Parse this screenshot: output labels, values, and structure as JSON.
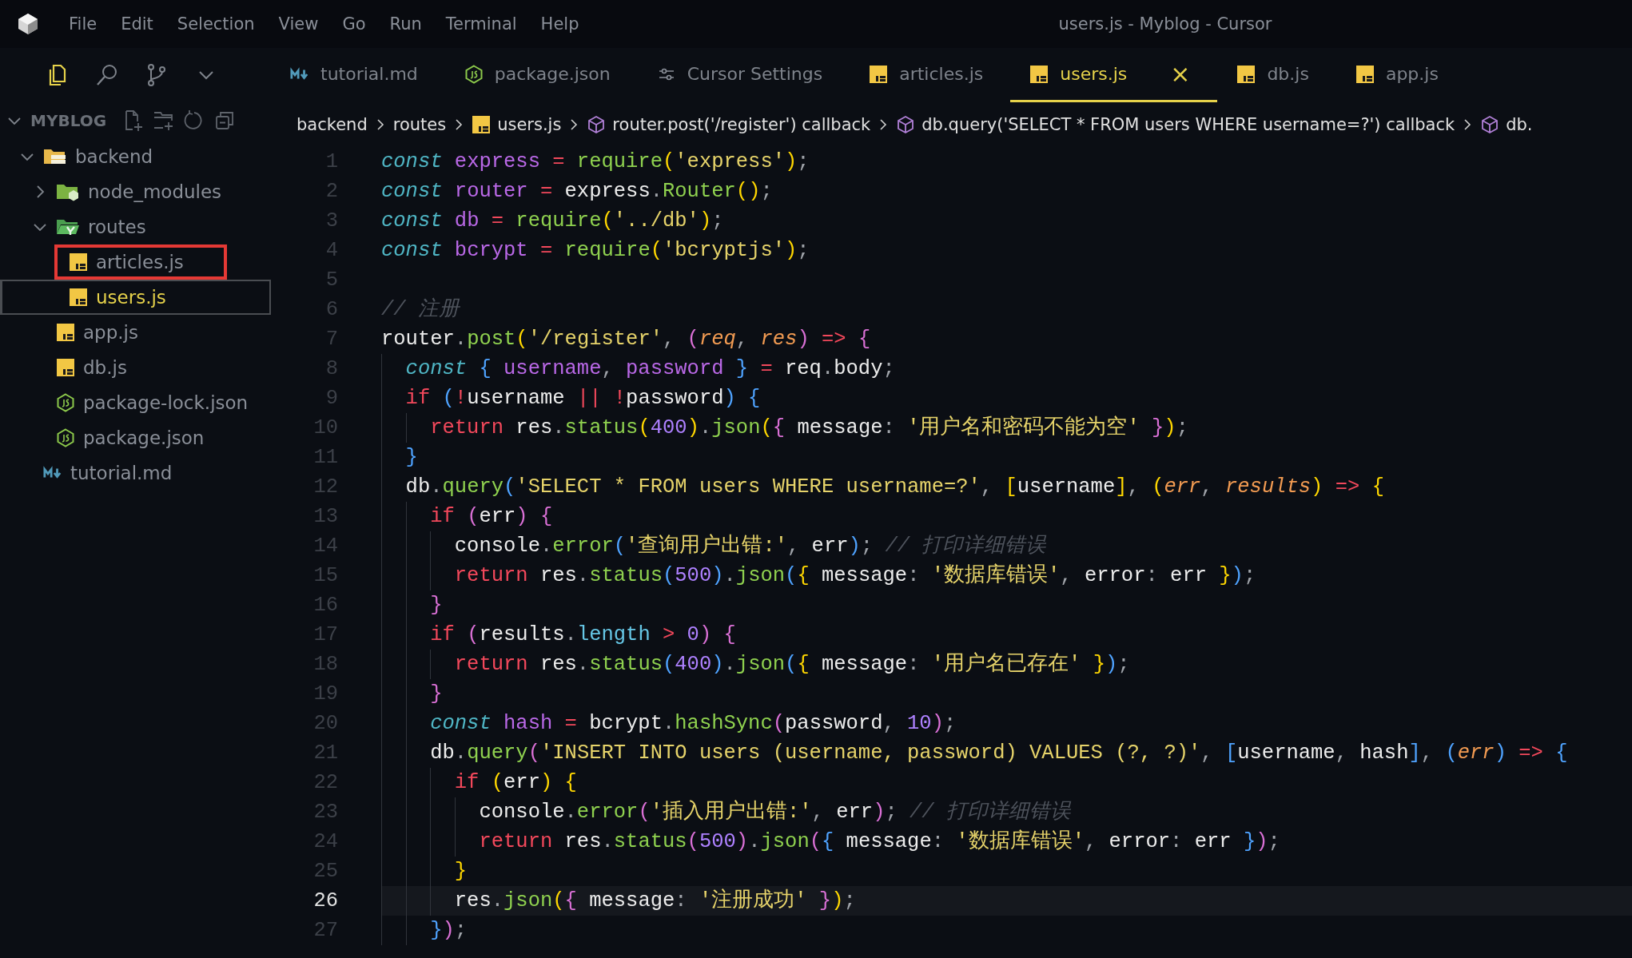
{
  "menu": {
    "items": [
      "File",
      "Edit",
      "Selection",
      "View",
      "Go",
      "Run",
      "Terminal",
      "Help"
    ]
  },
  "window": {
    "title": "users.js - Myblog - Cursor"
  },
  "tabs": [
    {
      "label": "tutorial.md",
      "kind": "md",
      "selected": false
    },
    {
      "label": "package.json",
      "kind": "json",
      "selected": false
    },
    {
      "label": "Cursor Settings",
      "kind": "settings",
      "selected": false
    },
    {
      "label": "articles.js",
      "kind": "js",
      "selected": false
    },
    {
      "label": "users.js",
      "kind": "js",
      "selected": true,
      "close": "×"
    },
    {
      "label": "db.js",
      "kind": "js",
      "selected": false
    },
    {
      "label": "app.js",
      "kind": "js",
      "selected": false
    }
  ],
  "explorer": {
    "title": "MYBLOG",
    "items": [
      {
        "label": "backend",
        "kind": "server-folder",
        "expanded": true,
        "selected": false,
        "annotated": false,
        "children": [
          {
            "label": "node_modules",
            "kind": "package-folder",
            "expanded": false,
            "selected": false,
            "annotated": false
          },
          {
            "label": "routes",
            "kind": "route-folder",
            "expanded": true,
            "selected": false,
            "annotated": false,
            "children": [
              {
                "label": "articles.js",
                "kind": "js",
                "selected": false,
                "annotated": true
              },
              {
                "label": "users.js",
                "kind": "js",
                "selected": true,
                "annotated": false
              }
            ]
          },
          {
            "label": "app.js",
            "kind": "js",
            "selected": false,
            "annotated": false
          },
          {
            "label": "db.js",
            "kind": "js",
            "selected": false,
            "annotated": false
          },
          {
            "label": "package-lock.json",
            "kind": "json",
            "selected": false,
            "annotated": false
          },
          {
            "label": "package.json",
            "kind": "json",
            "selected": false,
            "annotated": false
          }
        ]
      },
      {
        "label": "tutorial.md",
        "kind": "md",
        "selected": false,
        "annotated": false
      }
    ]
  },
  "breadcrumb": [
    {
      "label": "backend",
      "kind": "folder"
    },
    {
      "label": "routes",
      "kind": "folder"
    },
    {
      "label": "users.js",
      "kind": "js"
    },
    {
      "label": "router.post('/register') callback",
      "kind": "symbol"
    },
    {
      "label": "db.query('SELECT * FROM users WHERE username=?') callback",
      "kind": "symbol"
    },
    {
      "label": "db.",
      "kind": "symbol"
    }
  ],
  "code": {
    "lines": [
      {
        "number": "1",
        "current": false,
        "tokens": [
          {
            "kind": "kw",
            "text": "const "
          },
          {
            "kind": "v",
            "text": "express "
          },
          {
            "kind": "c",
            "text": "= "
          },
          {
            "kind": "f",
            "text": "require"
          },
          {
            "kind": "b1",
            "text": "("
          },
          {
            "kind": "s",
            "text": "'express'"
          },
          {
            "kind": "b1",
            "text": ")"
          },
          {
            "kind": "d",
            "text": ";"
          }
        ]
      },
      {
        "number": "2",
        "current": false,
        "tokens": [
          {
            "kind": "kw",
            "text": "const "
          },
          {
            "kind": "v",
            "text": "router "
          },
          {
            "kind": "c",
            "text": "= "
          },
          {
            "kind": "p",
            "text": "express"
          },
          {
            "kind": "d",
            "text": "."
          },
          {
            "kind": "f",
            "text": "Router"
          },
          {
            "kind": "b1",
            "text": "()"
          },
          {
            "kind": "d",
            "text": ";"
          }
        ]
      },
      {
        "number": "3",
        "current": false,
        "tokens": [
          {
            "kind": "kw",
            "text": "const "
          },
          {
            "kind": "v",
            "text": "db "
          },
          {
            "kind": "c",
            "text": "= "
          },
          {
            "kind": "f",
            "text": "require"
          },
          {
            "kind": "b1",
            "text": "("
          },
          {
            "kind": "s",
            "text": "'../db'"
          },
          {
            "kind": "b1",
            "text": ")"
          },
          {
            "kind": "d",
            "text": ";"
          }
        ]
      },
      {
        "number": "4",
        "current": false,
        "tokens": [
          {
            "kind": "kw",
            "text": "const "
          },
          {
            "kind": "v",
            "text": "bcrypt "
          },
          {
            "kind": "c",
            "text": "= "
          },
          {
            "kind": "f",
            "text": "require"
          },
          {
            "kind": "b1",
            "text": "("
          },
          {
            "kind": "s",
            "text": "'bcryptjs'"
          },
          {
            "kind": "b1",
            "text": ")"
          },
          {
            "kind": "d",
            "text": ";"
          }
        ]
      },
      {
        "number": "5",
        "current": false
      },
      {
        "number": "6",
        "current": false,
        "tokens": [
          {
            "kind": "cm",
            "text": "// 注册"
          }
        ]
      },
      {
        "number": "7",
        "current": false,
        "tokens": [
          {
            "kind": "p",
            "text": "router"
          },
          {
            "kind": "d",
            "text": "."
          },
          {
            "kind": "f",
            "text": "post"
          },
          {
            "kind": "b1",
            "text": "("
          },
          {
            "kind": "s",
            "text": "'/register'"
          },
          {
            "kind": "d",
            "text": ", "
          },
          {
            "kind": "b2",
            "text": "("
          },
          {
            "kind": "pa",
            "text": "req"
          },
          {
            "kind": "d",
            "text": ", "
          },
          {
            "kind": "pa",
            "text": "res"
          },
          {
            "kind": "b2",
            "text": ")"
          },
          {
            "kind": "c",
            "text": " => "
          },
          {
            "kind": "b2",
            "text": "{"
          }
        ]
      },
      {
        "number": "8",
        "current": false,
        "tokens": [
          {
            "kind": "kw",
            "text": "  const "
          },
          {
            "kind": "b3",
            "text": "{ "
          },
          {
            "kind": "v",
            "text": "username"
          },
          {
            "kind": "d",
            "text": ", "
          },
          {
            "kind": "v",
            "text": "password "
          },
          {
            "kind": "b3",
            "text": "} "
          },
          {
            "kind": "c",
            "text": "= "
          },
          {
            "kind": "p",
            "text": "req"
          },
          {
            "kind": "d",
            "text": "."
          },
          {
            "kind": "p",
            "text": "body"
          },
          {
            "kind": "d",
            "text": ";"
          }
        ]
      },
      {
        "number": "9",
        "current": false,
        "tokens": [
          {
            "kind": "c",
            "text": "  if "
          },
          {
            "kind": "b3",
            "text": "("
          },
          {
            "kind": "c",
            "text": "!"
          },
          {
            "kind": "p",
            "text": "username "
          },
          {
            "kind": "c",
            "text": "|| !"
          },
          {
            "kind": "p",
            "text": "password"
          },
          {
            "kind": "b3",
            "text": ") {"
          }
        ]
      },
      {
        "number": "10",
        "current": false,
        "tokens": [
          {
            "kind": "c",
            "text": "    return "
          },
          {
            "kind": "p",
            "text": "res"
          },
          {
            "kind": "d",
            "text": "."
          },
          {
            "kind": "f",
            "text": "status"
          },
          {
            "kind": "b1",
            "text": "("
          },
          {
            "kind": "n",
            "text": "400"
          },
          {
            "kind": "b1",
            "text": ")"
          },
          {
            "kind": "d",
            "text": "."
          },
          {
            "kind": "f",
            "text": "json"
          },
          {
            "kind": "b1",
            "text": "("
          },
          {
            "kind": "b2",
            "text": "{ "
          },
          {
            "kind": "p",
            "text": "message"
          },
          {
            "kind": "d",
            "text": ": "
          },
          {
            "kind": "s",
            "text": "'用户名和密码不能为空' "
          },
          {
            "kind": "b2",
            "text": "}"
          },
          {
            "kind": "b1",
            "text": ")"
          },
          {
            "kind": "d",
            "text": ";"
          }
        ]
      },
      {
        "number": "11",
        "current": false,
        "tokens": [
          {
            "kind": "b3",
            "text": "  }"
          }
        ]
      },
      {
        "number": "12",
        "current": false,
        "tokens": [
          {
            "kind": "p",
            "text": "  db"
          },
          {
            "kind": "d",
            "text": "."
          },
          {
            "kind": "f",
            "text": "query"
          },
          {
            "kind": "b3",
            "text": "("
          },
          {
            "kind": "s",
            "text": "'SELECT * FROM users WHERE username=?'"
          },
          {
            "kind": "d",
            "text": ", "
          },
          {
            "kind": "b1",
            "text": "["
          },
          {
            "kind": "p",
            "text": "username"
          },
          {
            "kind": "b1",
            "text": "]"
          },
          {
            "kind": "d",
            "text": ", "
          },
          {
            "kind": "b1",
            "text": "("
          },
          {
            "kind": "pa",
            "text": "err"
          },
          {
            "kind": "d",
            "text": ", "
          },
          {
            "kind": "pa",
            "text": "results"
          },
          {
            "kind": "b1",
            "text": ")"
          },
          {
            "kind": "c",
            "text": " => "
          },
          {
            "kind": "b1",
            "text": "{"
          }
        ]
      },
      {
        "number": "13",
        "current": false,
        "tokens": [
          {
            "kind": "c",
            "text": "    if "
          },
          {
            "kind": "b2",
            "text": "("
          },
          {
            "kind": "p",
            "text": "err"
          },
          {
            "kind": "b2",
            "text": ") {"
          }
        ]
      },
      {
        "number": "14",
        "current": false,
        "tokens": [
          {
            "kind": "p",
            "text": "      console"
          },
          {
            "kind": "d",
            "text": "."
          },
          {
            "kind": "f",
            "text": "error"
          },
          {
            "kind": "b3",
            "text": "("
          },
          {
            "kind": "s",
            "text": "'查询用户出错:'"
          },
          {
            "kind": "d",
            "text": ", "
          },
          {
            "kind": "p",
            "text": "err"
          },
          {
            "kind": "b3",
            "text": ")"
          },
          {
            "kind": "d",
            "text": "; "
          },
          {
            "kind": "cm",
            "text": "// 打印详细错误"
          }
        ]
      },
      {
        "number": "15",
        "current": false,
        "tokens": [
          {
            "kind": "c",
            "text": "      return "
          },
          {
            "kind": "p",
            "text": "res"
          },
          {
            "kind": "d",
            "text": "."
          },
          {
            "kind": "f",
            "text": "status"
          },
          {
            "kind": "b3",
            "text": "("
          },
          {
            "kind": "n",
            "text": "500"
          },
          {
            "kind": "b3",
            "text": ")"
          },
          {
            "kind": "d",
            "text": "."
          },
          {
            "kind": "f",
            "text": "json"
          },
          {
            "kind": "b3",
            "text": "("
          },
          {
            "kind": "b1",
            "text": "{ "
          },
          {
            "kind": "p",
            "text": "message"
          },
          {
            "kind": "d",
            "text": ": "
          },
          {
            "kind": "s",
            "text": "'数据库错误'"
          },
          {
            "kind": "d",
            "text": ", "
          },
          {
            "kind": "p",
            "text": "error"
          },
          {
            "kind": "d",
            "text": ": "
          },
          {
            "kind": "p",
            "text": "err "
          },
          {
            "kind": "b1",
            "text": "}"
          },
          {
            "kind": "b3",
            "text": ")"
          },
          {
            "kind": "d",
            "text": ";"
          }
        ]
      },
      {
        "number": "16",
        "current": false,
        "tokens": [
          {
            "kind": "b2",
            "text": "    }"
          }
        ]
      },
      {
        "number": "17",
        "current": false,
        "tokens": [
          {
            "kind": "c",
            "text": "    if "
          },
          {
            "kind": "b2",
            "text": "("
          },
          {
            "kind": "p",
            "text": "results"
          },
          {
            "kind": "d",
            "text": "."
          },
          {
            "kind": "pr",
            "text": "length "
          },
          {
            "kind": "c",
            "text": "> "
          },
          {
            "kind": "n",
            "text": "0"
          },
          {
            "kind": "b2",
            "text": ") {"
          }
        ]
      },
      {
        "number": "18",
        "current": false,
        "tokens": [
          {
            "kind": "c",
            "text": "      return "
          },
          {
            "kind": "p",
            "text": "res"
          },
          {
            "kind": "d",
            "text": "."
          },
          {
            "kind": "f",
            "text": "status"
          },
          {
            "kind": "b3",
            "text": "("
          },
          {
            "kind": "n",
            "text": "400"
          },
          {
            "kind": "b3",
            "text": ")"
          },
          {
            "kind": "d",
            "text": "."
          },
          {
            "kind": "f",
            "text": "json"
          },
          {
            "kind": "b3",
            "text": "("
          },
          {
            "kind": "b1",
            "text": "{ "
          },
          {
            "kind": "p",
            "text": "message"
          },
          {
            "kind": "d",
            "text": ": "
          },
          {
            "kind": "s",
            "text": "'用户名已存在' "
          },
          {
            "kind": "b1",
            "text": "}"
          },
          {
            "kind": "b3",
            "text": ")"
          },
          {
            "kind": "d",
            "text": ";"
          }
        ]
      },
      {
        "number": "19",
        "current": false,
        "tokens": [
          {
            "kind": "b2",
            "text": "    }"
          }
        ]
      },
      {
        "number": "20",
        "current": false,
        "tokens": [
          {
            "kind": "kw",
            "text": "    const "
          },
          {
            "kind": "v",
            "text": "hash "
          },
          {
            "kind": "c",
            "text": "= "
          },
          {
            "kind": "p",
            "text": "bcrypt"
          },
          {
            "kind": "d",
            "text": "."
          },
          {
            "kind": "f",
            "text": "hashSync"
          },
          {
            "kind": "b2",
            "text": "("
          },
          {
            "kind": "p",
            "text": "password"
          },
          {
            "kind": "d",
            "text": ", "
          },
          {
            "kind": "n",
            "text": "10"
          },
          {
            "kind": "b2",
            "text": ")"
          },
          {
            "kind": "d",
            "text": ";"
          }
        ]
      },
      {
        "number": "21",
        "current": false,
        "tokens": [
          {
            "kind": "p",
            "text": "    db"
          },
          {
            "kind": "d",
            "text": "."
          },
          {
            "kind": "f",
            "text": "query"
          },
          {
            "kind": "b2",
            "text": "("
          },
          {
            "kind": "s",
            "text": "'INSERT INTO users (username, password) VALUES (?, ?)'"
          },
          {
            "kind": "d",
            "text": ", "
          },
          {
            "kind": "b3",
            "text": "["
          },
          {
            "kind": "p",
            "text": "username"
          },
          {
            "kind": "d",
            "text": ", "
          },
          {
            "kind": "p",
            "text": "hash"
          },
          {
            "kind": "b3",
            "text": "]"
          },
          {
            "kind": "d",
            "text": ", "
          },
          {
            "kind": "b3",
            "text": "("
          },
          {
            "kind": "pa",
            "text": "err"
          },
          {
            "kind": "b3",
            "text": ")"
          },
          {
            "kind": "c",
            "text": " => "
          },
          {
            "kind": "b3",
            "text": "{"
          }
        ]
      },
      {
        "number": "22",
        "current": false,
        "tokens": [
          {
            "kind": "c",
            "text": "      if "
          },
          {
            "kind": "b1",
            "text": "("
          },
          {
            "kind": "p",
            "text": "err"
          },
          {
            "kind": "b1",
            "text": ") {"
          }
        ]
      },
      {
        "number": "23",
        "current": false,
        "tokens": [
          {
            "kind": "p",
            "text": "        console"
          },
          {
            "kind": "d",
            "text": "."
          },
          {
            "kind": "f",
            "text": "error"
          },
          {
            "kind": "b2",
            "text": "("
          },
          {
            "kind": "s",
            "text": "'插入用户出错:'"
          },
          {
            "kind": "d",
            "text": ", "
          },
          {
            "kind": "p",
            "text": "err"
          },
          {
            "kind": "b2",
            "text": ")"
          },
          {
            "kind": "d",
            "text": "; "
          },
          {
            "kind": "cm",
            "text": "// 打印详细错误"
          }
        ]
      },
      {
        "number": "24",
        "current": false,
        "tokens": [
          {
            "kind": "c",
            "text": "        return "
          },
          {
            "kind": "p",
            "text": "res"
          },
          {
            "kind": "d",
            "text": "."
          },
          {
            "kind": "f",
            "text": "status"
          },
          {
            "kind": "b2",
            "text": "("
          },
          {
            "kind": "n",
            "text": "500"
          },
          {
            "kind": "b2",
            "text": ")"
          },
          {
            "kind": "d",
            "text": "."
          },
          {
            "kind": "f",
            "text": "json"
          },
          {
            "kind": "b2",
            "text": "("
          },
          {
            "kind": "b3",
            "text": "{ "
          },
          {
            "kind": "p",
            "text": "message"
          },
          {
            "kind": "d",
            "text": ": "
          },
          {
            "kind": "s",
            "text": "'数据库错误'"
          },
          {
            "kind": "d",
            "text": ", "
          },
          {
            "kind": "p",
            "text": "error"
          },
          {
            "kind": "d",
            "text": ": "
          },
          {
            "kind": "p",
            "text": "err "
          },
          {
            "kind": "b3",
            "text": "}"
          },
          {
            "kind": "b2",
            "text": ")"
          },
          {
            "kind": "d",
            "text": ";"
          }
        ]
      },
      {
        "number": "25",
        "current": false,
        "tokens": [
          {
            "kind": "b1",
            "text": "      }"
          }
        ]
      },
      {
        "number": "26",
        "current": true,
        "tokens": [
          {
            "kind": "p",
            "text": "      res"
          },
          {
            "kind": "d",
            "text": "."
          },
          {
            "kind": "f",
            "text": "json"
          },
          {
            "kind": "b1",
            "text": "("
          },
          {
            "kind": "b2",
            "text": "{ "
          },
          {
            "kind": "p",
            "text": "message"
          },
          {
            "kind": "d",
            "text": ": "
          },
          {
            "kind": "s",
            "text": "'注册成功' "
          },
          {
            "kind": "b2",
            "text": "}"
          },
          {
            "kind": "b1",
            "text": ")"
          },
          {
            "kind": "d",
            "text": ";"
          }
        ]
      },
      {
        "number": "27",
        "current": false,
        "tokens": [
          {
            "kind": "b3",
            "text": "    }"
          },
          {
            "kind": "b2",
            "text": ")"
          },
          {
            "kind": "d",
            "text": ";"
          }
        ]
      }
    ]
  }
}
